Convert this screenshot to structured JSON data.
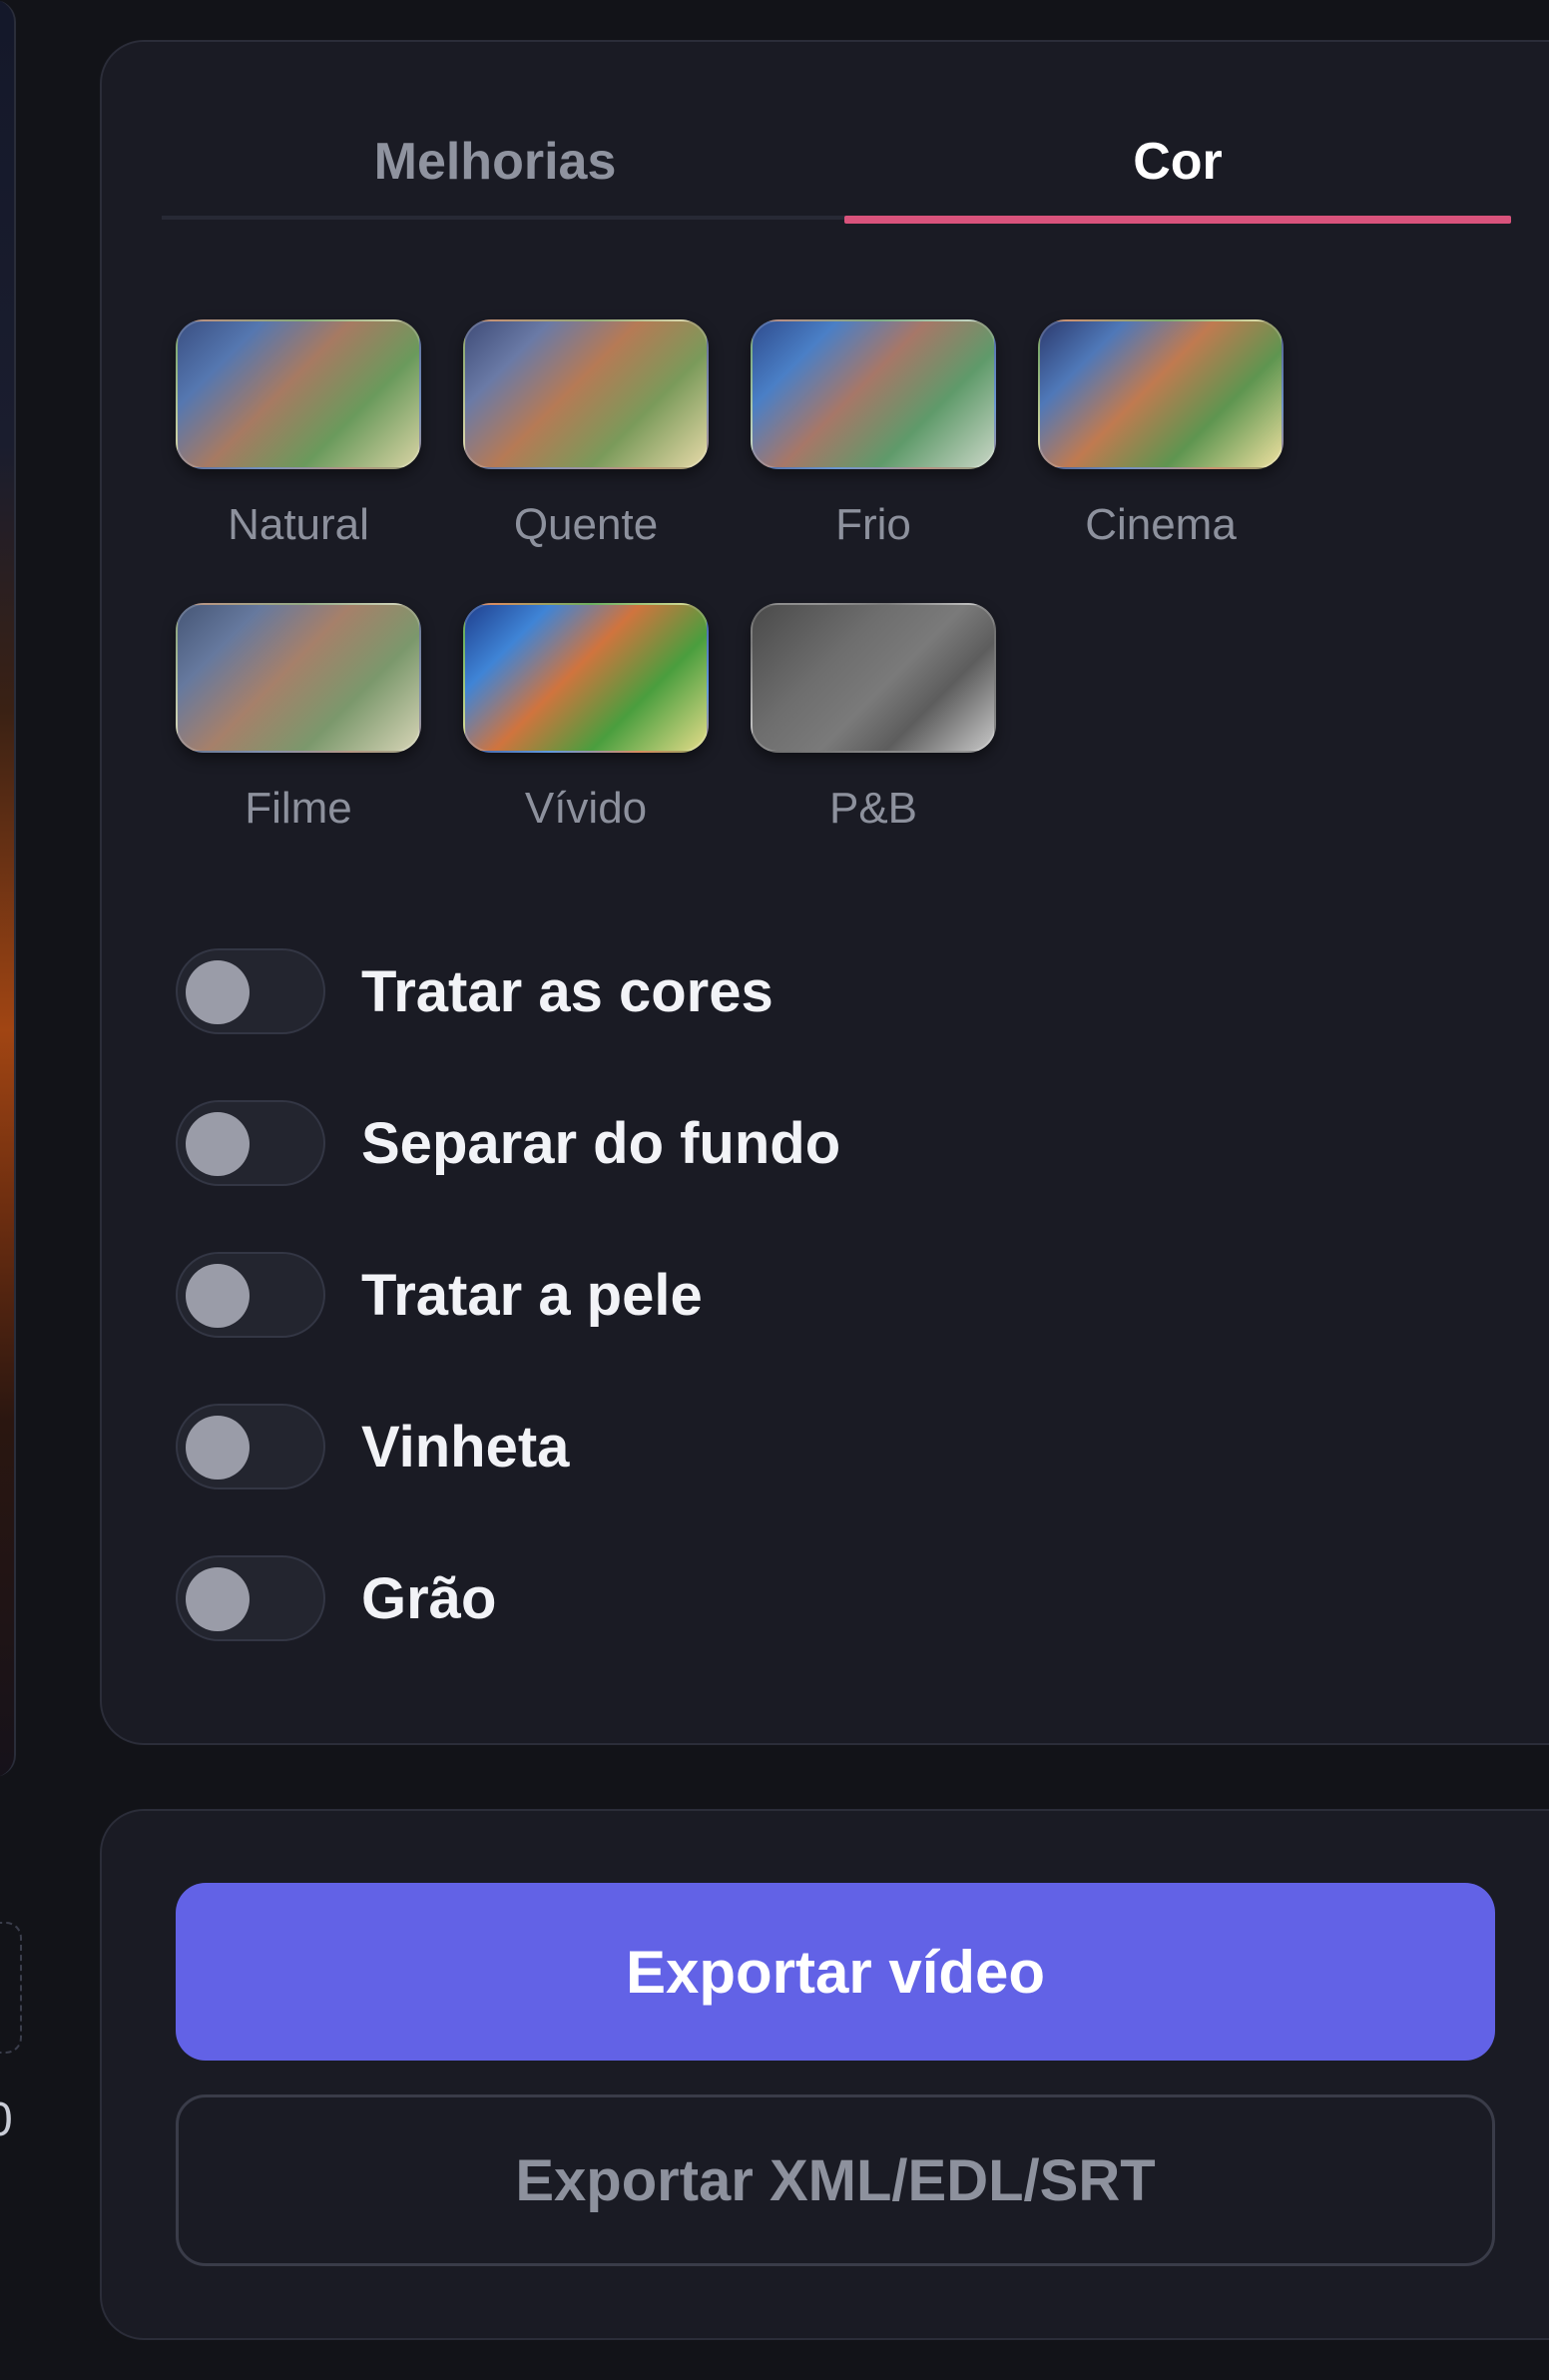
{
  "tabs": [
    {
      "label": "Melhorias",
      "active": false
    },
    {
      "label": "Cor",
      "active": true
    }
  ],
  "accent_color": "#d9537c",
  "presets": [
    {
      "label": "Natural",
      "gradient": "linear-gradient(135deg,#3a4f82 0%,#5577b0 22%,#a77a62 45%,#6a9a5c 70%,#d8d3a4 100%)"
    },
    {
      "label": "Quente",
      "gradient": "linear-gradient(135deg,#3f4c78 0%,#6a7aa6 22%,#b67a55 45%,#7a9a5a 70%,#e6d9a8 100%)"
    },
    {
      "label": "Frio",
      "gradient": "linear-gradient(135deg,#2f4c8e 0%,#4a7fc6 22%,#a77768 45%,#5f9a6a 70%,#c9d6c6 100%)"
    },
    {
      "label": "Cinema",
      "gradient": "linear-gradient(135deg,#2c3a6e 0%,#4f78b8 22%,#c07a50 45%,#5e9550 70%,#eee0a0 100%)"
    },
    {
      "label": "Filme",
      "gradient": "linear-gradient(135deg,#465676 0%,#66799e 22%,#a6806a 45%,#7b986c 70%,#d6d4b6 100%)"
    },
    {
      "label": "Vívido",
      "gradient": "linear-gradient(135deg,#1f3f8e 0%,#3f84d6 22%,#d0743e 45%,#4a9e3e 70%,#e4dc8a 100%)"
    },
    {
      "label": "P&B",
      "gradient": "linear-gradient(135deg,#4a4a4a 0%,#6e6e6e 35%,#7a7a7a 55%,#5d5d5d 72%,#c8c8c8 100%)"
    }
  ],
  "toggles": [
    {
      "label": "Tratar as cores",
      "on": false
    },
    {
      "label": "Separar do fundo",
      "on": false
    },
    {
      "label": "Tratar a pele",
      "on": false
    },
    {
      "label": "Vinheta",
      "on": false
    },
    {
      "label": "Grão",
      "on": false
    }
  ],
  "actions": {
    "export_video": "Exportar vídeo",
    "export_xml": "Exportar XML/EDL/SRT"
  },
  "left_strip_digit": "0"
}
